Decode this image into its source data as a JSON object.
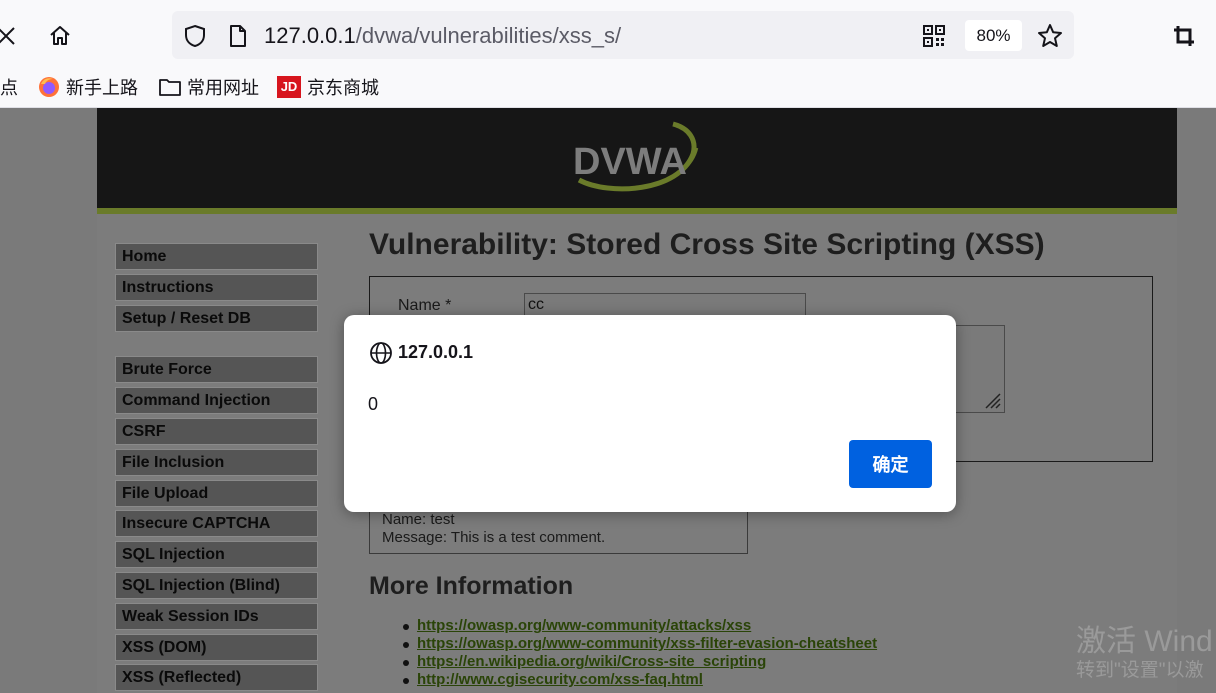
{
  "browser": {
    "url_host": "127.0.0.1",
    "url_path": "/dvwa/vulnerabilities/xss_s/",
    "zoom": "80%",
    "icons": [
      "close-icon",
      "home-icon",
      "shield-icon",
      "page-icon",
      "qr-code-icon",
      "star-icon",
      "crop-icon"
    ]
  },
  "bookmarks": {
    "partial_label": "点",
    "items": [
      {
        "label": "新手上路",
        "icon": "firefox-icon"
      },
      {
        "label": "常用网址",
        "icon": "folder-icon"
      },
      {
        "label": "京东商城",
        "icon": "jd-icon"
      }
    ]
  },
  "page": {
    "logo_text": "DVWA",
    "title": "Vulnerability: Stored Cross Site Scripting (XSS)",
    "form": {
      "name_label": "Name *",
      "name_value": "cc"
    },
    "comment": {
      "name_line": "Name: test",
      "message_line": "Message: This is a test comment."
    },
    "more_info_heading": "More Information",
    "links": [
      "https://owasp.org/www-community/attacks/xss",
      "https://owasp.org/www-community/xss-filter-evasion-cheatsheet",
      "https://en.wikipedia.org/wiki/Cross-site_scripting",
      "http://www.cgisecurity.com/xss-faq.html"
    ],
    "menu_group1": [
      "Home",
      "Instructions",
      "Setup / Reset DB"
    ],
    "menu_group2": [
      "Brute Force",
      "Command Injection",
      "CSRF",
      "File Inclusion",
      "File Upload",
      "Insecure CAPTCHA",
      "SQL Injection",
      "SQL Injection (Blind)",
      "Weak Session IDs",
      "XSS (DOM)",
      "XSS (Reflected)"
    ]
  },
  "dialog": {
    "title": "127.0.0.1",
    "message": "0",
    "ok_label": "确定"
  },
  "watermark": {
    "line1": "激活 Wind",
    "line2": "转到\"设置\"以激"
  },
  "colors": {
    "accent": "#0061e0",
    "dvwa_green": "#6a7b2a",
    "header_bg": "#161616",
    "link": "#2a4408"
  }
}
